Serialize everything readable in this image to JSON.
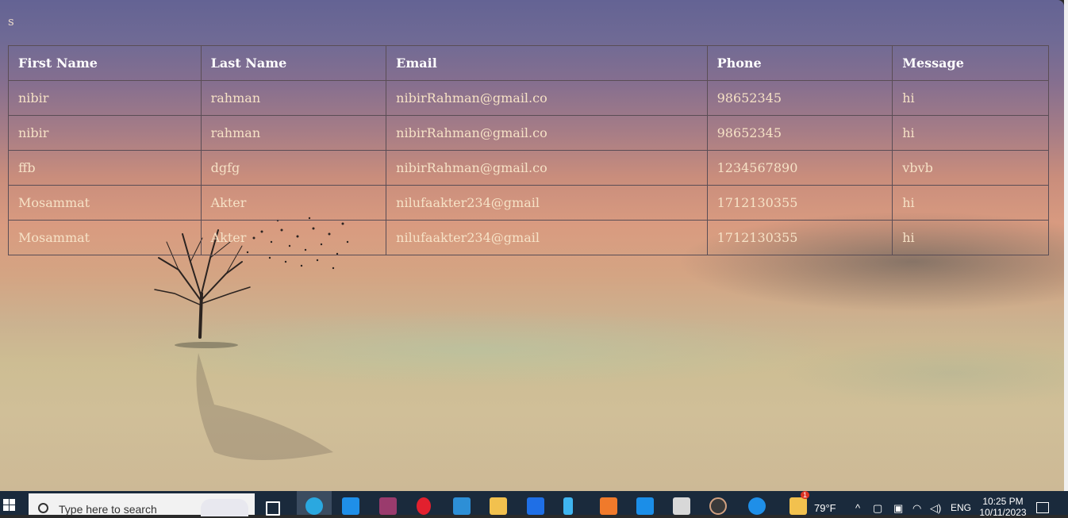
{
  "page": {
    "label": "s"
  },
  "table": {
    "headers": [
      "First Name",
      "Last Name",
      "Email",
      "Phone",
      "Message"
    ],
    "rows": [
      [
        "nibir",
        "rahman",
        "nibirRahman@gmail.co",
        "98652345",
        "hi"
      ],
      [
        "nibir",
        "rahman",
        "nibirRahman@gmail.co",
        "98652345",
        "hi"
      ],
      [
        "ffb",
        "dgfg",
        "nibirRahman@gmail.co",
        "1234567890",
        "vbvb"
      ],
      [
        "Mosammat",
        "Akter",
        "nilufaakter234@gmail",
        "1712130355",
        "hi"
      ],
      [
        "Mosammat",
        "Akter",
        "nilufaakter234@gmail",
        "1712130355",
        "hi"
      ]
    ]
  },
  "taskbar": {
    "search_placeholder": "Type here to search",
    "weather": "79°F",
    "language": "ENG",
    "time": "10:25 PM",
    "date": "10/11/2023",
    "mail_badge": "1",
    "apps": [
      "task-view-icon",
      "edge-icon",
      "mail-icon",
      "winrar-icon",
      "opera-icon",
      "store-icon",
      "file-explorer-icon",
      "dropbox-icon",
      "flutter-icon",
      "xampp-icon",
      "vscode-icon",
      "media-player-icon",
      "play-icon",
      "help-icon",
      "weather-icon"
    ]
  }
}
